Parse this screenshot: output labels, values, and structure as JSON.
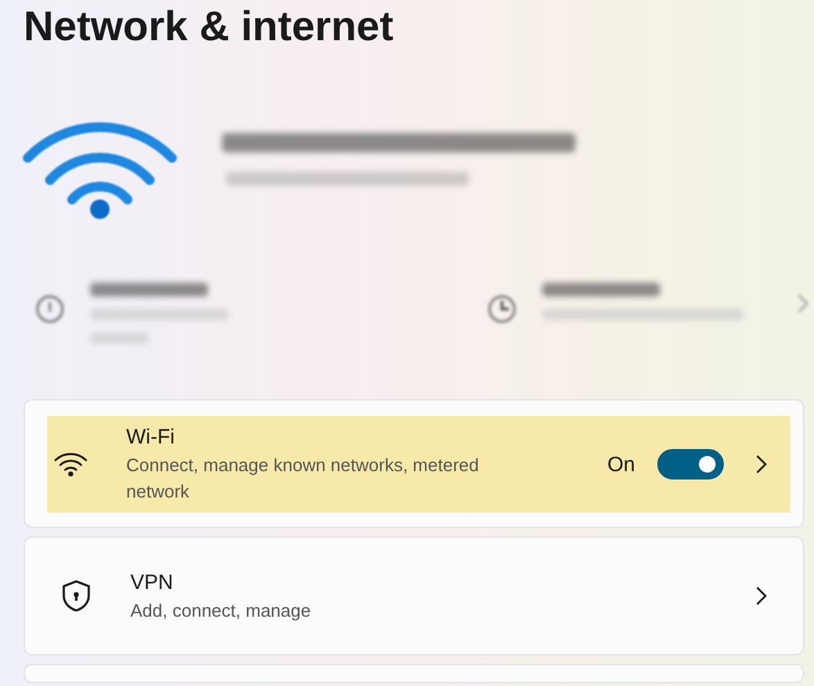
{
  "page": {
    "title": "Network & internet"
  },
  "items": [
    {
      "kind": "wifi",
      "title": "Wi-Fi",
      "description": "Connect, manage known networks, metered network",
      "highlighted": true,
      "toggle": {
        "label": "On",
        "on": true
      }
    },
    {
      "kind": "vpn",
      "title": "VPN",
      "description": "Add, connect, manage",
      "highlighted": false
    }
  ]
}
